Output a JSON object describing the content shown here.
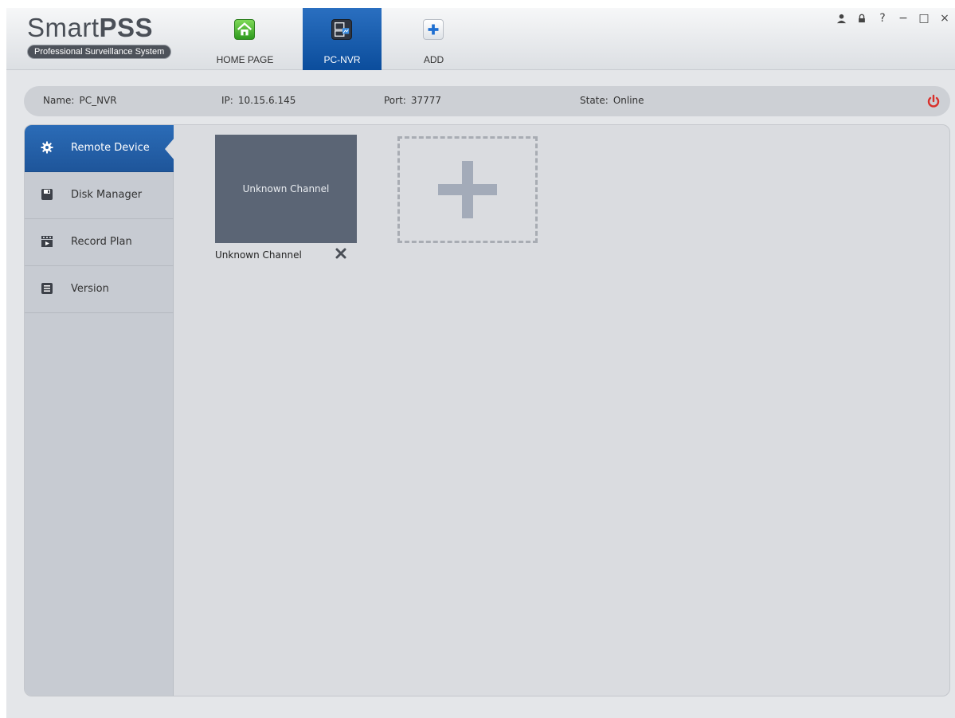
{
  "app": {
    "logo_main": "Smart",
    "logo_bold": "PSS",
    "logo_sub": "Professional Surveillance System"
  },
  "tabs": [
    {
      "label": "HOME PAGE",
      "icon": "home-icon",
      "active": false
    },
    {
      "label": "PC-NVR",
      "icon": "pc-nvr-icon",
      "active": true
    },
    {
      "label": "ADD",
      "icon": "add-icon",
      "active": false
    }
  ],
  "window_controls": {
    "user": "user-icon",
    "lock": "lock-icon",
    "help": "?",
    "minimize": "−",
    "maximize": "□",
    "close": "×"
  },
  "device_info": {
    "name_label": "Name:",
    "name_value": "PC_NVR",
    "ip_label": "IP:",
    "ip_value": "10.15.6.145",
    "port_label": "Port:",
    "port_value": "37777",
    "state_label": "State:",
    "state_value": "Online"
  },
  "sidebar": {
    "items": [
      {
        "label": "Remote Device",
        "icon": "gear-icon",
        "active": true
      },
      {
        "label": "Disk Manager",
        "icon": "disk-icon",
        "active": false
      },
      {
        "label": "Record Plan",
        "icon": "record-plan-icon",
        "active": false
      },
      {
        "label": "Version",
        "icon": "version-icon",
        "active": false
      }
    ]
  },
  "channels": [
    {
      "card_label": "Unknown Channel",
      "caption": "Unknown Channel"
    }
  ],
  "colors": {
    "accent": "#1e559a",
    "power": "#d9302b",
    "channel_bg": "#5b6575"
  }
}
